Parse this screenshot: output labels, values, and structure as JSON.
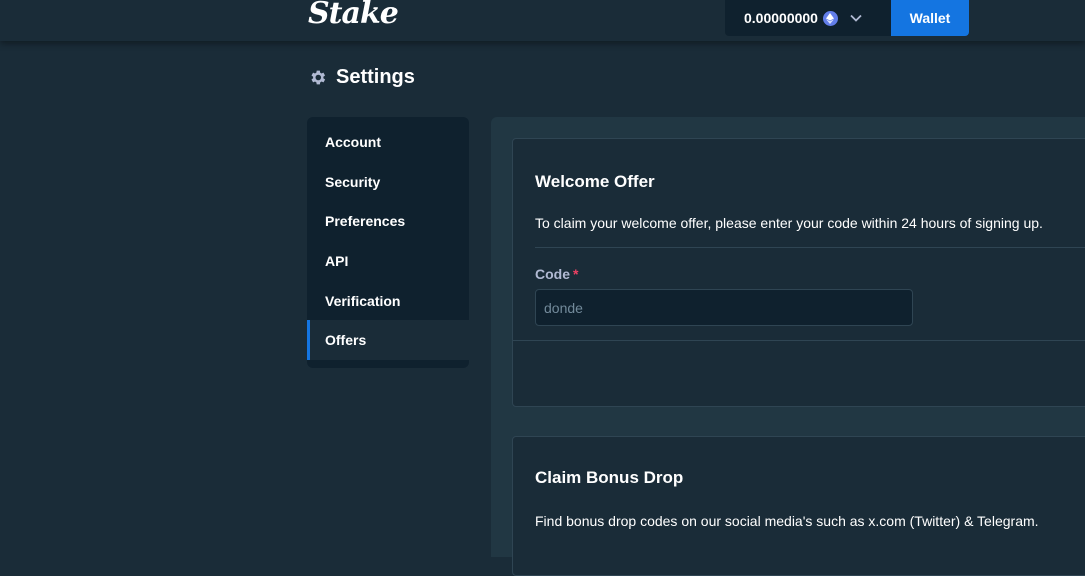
{
  "header": {
    "logo_text": "Stake",
    "balance": "0.00000000",
    "currency_icon": "ethereum-icon",
    "wallet_label": "Wallet"
  },
  "page": {
    "title": "Settings",
    "title_icon": "gear-icon"
  },
  "sidebar": {
    "items": [
      {
        "label": "Account"
      },
      {
        "label": "Security"
      },
      {
        "label": "Preferences"
      },
      {
        "label": "API"
      },
      {
        "label": "Verification"
      },
      {
        "label": "Offers",
        "active": true
      }
    ]
  },
  "welcome_offer": {
    "title": "Welcome Offer",
    "description": "To claim your welcome offer, please enter your code within 24 hours of signing up.",
    "code_label": "Code",
    "required_mark": "*",
    "code_placeholder": "donde",
    "code_value": ""
  },
  "bonus_drop": {
    "title": "Claim Bonus Drop",
    "description": "Find bonus drop codes on our social media's such as x.com (Twitter) & Telegram."
  },
  "colors": {
    "background": "#1a2c38",
    "panel": "#213743",
    "nav_bg": "#0f212e",
    "accent_blue": "#1475e1",
    "muted_text": "#b1bad3",
    "required_red": "#ed4163"
  }
}
